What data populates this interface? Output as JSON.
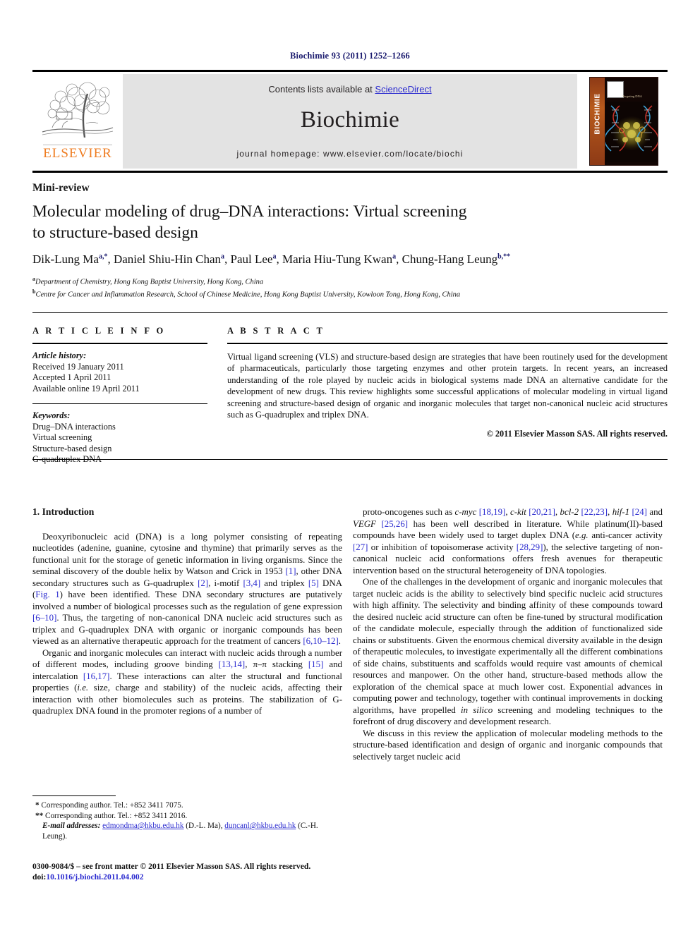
{
  "running_head": "Biochimie 93 (2011) 1252–1266",
  "banner": {
    "contents_prefix": "Contents lists available at ",
    "sciencedirect": "ScienceDirect",
    "journal_title": "Biochimie",
    "homepage": "journal homepage: www.elsevier.com/locate/biochi",
    "publisher_brand": "ELSEVIER",
    "cover_spine_text": "BIOCHIMIE",
    "cover_caption": "Targeting DNA",
    "accent_link_color": "#2b2bcf",
    "brand_color": "#ef7d22",
    "banner_bg_color": "#e3e3e3"
  },
  "article": {
    "type": "Mini-review",
    "title_line1": "Molecular modeling of drug–DNA interactions: Virtual screening",
    "title_line2": "to structure-based design",
    "authors": [
      {
        "name": "Dik-Lung Ma",
        "marks": "a,*"
      },
      {
        "name": "Daniel Shiu-Hin Chan",
        "marks": "a"
      },
      {
        "name": "Paul Lee",
        "marks": "a"
      },
      {
        "name": "Maria Hiu-Tung Kwan",
        "marks": "a"
      },
      {
        "name": "Chung-Hang Leung",
        "marks": "b,**"
      }
    ],
    "affiliations": [
      {
        "mark": "a",
        "text": "Department of Chemistry, Hong Kong Baptist University, Hong Kong, China"
      },
      {
        "mark": "b",
        "text": "Centre for Cancer and Inflammation Research, School of Chinese Medicine, Hong Kong Baptist University, Kowloon Tong, Hong Kong, China"
      }
    ]
  },
  "info": {
    "heading": "A R T I C L E  I N F O",
    "history_label": "Article history:",
    "history": [
      "Received 19 January 2011",
      "Accepted 1 April 2011",
      "Available online 19 April 2011"
    ],
    "keywords_label": "Keywords:",
    "keywords": [
      "Drug–DNA interactions",
      "Virtual screening",
      "Structure-based design",
      "G-quadruplex DNA"
    ]
  },
  "abstract": {
    "heading": "A B S T R A C T",
    "text": "Virtual ligand screening (VLS) and structure-based design are strategies that have been routinely used for the development of pharmaceuticals, particularly those targeting enzymes and other protein targets. In recent years, an increased understanding of the role played by nucleic acids in biological systems made DNA an alternative candidate for the development of new drugs. This review highlights some successful applications of molecular modeling in virtual ligand screening and structure-based design of organic and inorganic molecules that target non-canonical nucleic acid structures such as G-quadruplex and triplex DNA.",
    "copyright": "© 2011 Elsevier Masson SAS. All rights reserved."
  },
  "body": {
    "section_heading": "1. Introduction",
    "left_paragraphs": [
      "Deoxyribonucleic acid (DNA) is a long polymer consisting of repeating nucleotides (adenine, guanine, cytosine and thymine) that primarily serves as the functional unit for the storage of genetic information in living organisms. Since the seminal discovery of the double helix by Watson and Crick in 1953 [1], other DNA secondary structures such as G-quadruplex [2], i-motif [3,4] and triplex [5] DNA (Fig. 1) have been identified. These DNA secondary structures are putatively involved a number of biological processes such as the regulation of gene expression [6–10]. Thus, the targeting of non-canonical DNA nucleic acid structures such as triplex and G-quadruplex DNA with organic or inorganic compounds has been viewed as an alternative therapeutic approach for the treatment of cancers [6,10–12].",
      "Organic and inorganic molecules can interact with nucleic acids through a number of different modes, including groove binding [13,14], π–π stacking [15] and intercalation [16,17]. These interactions can alter the structural and functional properties (i.e. size, charge and stability) of the nucleic acids, affecting their interaction with other biomolecules such as proteins. The stabilization of G-quadruplex DNA found in the promoter regions of a number of"
    ],
    "right_paragraphs": [
      "proto-oncogenes such as c-myc [18,19], c-kit [20,21], bcl-2 [22,23], hif-1 [24] and VEGF [25,26] has been well described in literature. While platinum(II)-based compounds have been widely used to target duplex DNA (e.g. anti-cancer activity [27] or inhibition of topoisomerase activity [28,29]), the selective targeting of non-canonical nucleic acid conformations offers fresh avenues for therapeutic intervention based on the structural heterogeneity of DNA topologies.",
      "One of the challenges in the development of organic and inorganic molecules that target nucleic acids is the ability to selectively bind specific nucleic acid structures with high affinity. The selectivity and binding affinity of these compounds toward the desired nucleic acid structure can often be fine-tuned by structural modification of the candidate molecule, especially through the addition of functionalized side chains or substituents. Given the enormous chemical diversity available in the design of therapeutic molecules, to investigate experimentally all the different combinations of side chains, substituents and scaffolds would require vast amounts of chemical resources and manpower. On the other hand, structure-based methods allow the exploration of the chemical space at much lower cost. Exponential advances in computing power and technology, together with continual improvements in docking algorithms, have propelled in silico screening and modeling techniques to the forefront of drug discovery and development research.",
      "We discuss in this review the application of molecular modeling methods to the structure-based identification and design of organic and inorganic compounds that selectively target nucleic acid"
    ]
  },
  "footnotes": {
    "corresponding_1": "Corresponding author. Tel.: +852 3411 7075.",
    "corresponding_1_mark": "*",
    "corresponding_2": "Corresponding author. Tel.: +852 3411 2016.",
    "corresponding_2_mark": "**",
    "email_label": "E-mail addresses:",
    "email_1": "edmondma@hkbu.edu.hk",
    "email_1_owner": "(D.-L. Ma)",
    "email_2": "duncanl@hkbu.edu.hk",
    "email_2_owner": "(C.-H. Leung)."
  },
  "imprint": {
    "line1": "0300-9084/$ – see front matter © 2011 Elsevier Masson SAS. All rights reserved.",
    "doi_label": "doi:",
    "doi": "10.1016/j.biochi.2011.04.002"
  }
}
